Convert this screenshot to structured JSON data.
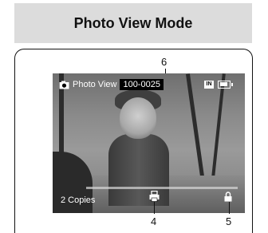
{
  "header": {
    "title": "Photo View Mode"
  },
  "osd": {
    "mode_label": "Photo View",
    "file_number": "100-0025",
    "memory_icon_text": "IN",
    "copies_label": "2 Copies"
  },
  "callouts": {
    "c6": "6",
    "c4": "4",
    "c5": "5"
  },
  "icons": [
    "camera-icon",
    "internal-memory-icon",
    "battery-icon",
    "print-icon",
    "lock-icon"
  ]
}
